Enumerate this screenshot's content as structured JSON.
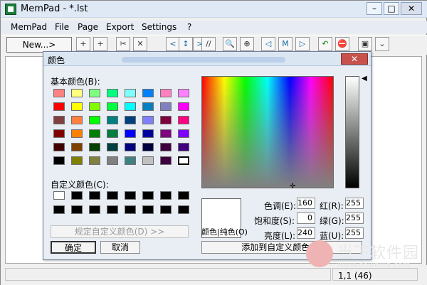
{
  "window": {
    "title": "MemPad - *.lst"
  },
  "menu": [
    "MemPad",
    "File",
    "Page",
    "Export",
    "Settings",
    "?"
  ],
  "toolbar": {
    "new_label": "New...>",
    "tools": [
      {
        "name": "add-page-icon",
        "glyph": "+"
      },
      {
        "name": "add-subpage-icon",
        "glyph": "+"
      },
      {
        "name": "cut-page-icon",
        "glyph": "✂"
      },
      {
        "name": "delete-page-icon",
        "glyph": "✕"
      },
      {
        "name": "move-left-icon",
        "glyph": "<"
      },
      {
        "name": "move-up-down-icon",
        "glyph": "↕"
      },
      {
        "name": "move-right-icon",
        "glyph": ">"
      },
      {
        "name": "comment-icon",
        "glyph": "//"
      },
      {
        "name": "search-icon",
        "glyph": "🔍"
      },
      {
        "name": "search-next-icon",
        "glyph": "⊕"
      },
      {
        "name": "prev-mark-icon",
        "glyph": "◁"
      },
      {
        "name": "mark-icon",
        "glyph": "M"
      },
      {
        "name": "next-mark-icon",
        "glyph": "▷"
      },
      {
        "name": "undo-icon",
        "glyph": "↶"
      },
      {
        "name": "stop-icon",
        "glyph": "⛔"
      },
      {
        "name": "window-icon",
        "glyph": "▣"
      },
      {
        "name": "expand-icon",
        "glyph": "⌄"
      }
    ]
  },
  "status": {
    "position": "1,1 (46)"
  },
  "color_dialog": {
    "title": "颜色",
    "close_label": "✕",
    "basic_colors_label": "基本颜色(B):",
    "basic_colors": [
      "#ff8080",
      "#ffff80",
      "#80ff80",
      "#00ff80",
      "#80ffff",
      "#0080ff",
      "#ff80c0",
      "#ff80ff",
      "#ff0000",
      "#ffff00",
      "#80ff00",
      "#00ff40",
      "#00ffff",
      "#0080c0",
      "#8080c0",
      "#ff00ff",
      "#804040",
      "#ff8040",
      "#00ff00",
      "#008080",
      "#004080",
      "#8080ff",
      "#800040",
      "#ff0080",
      "#800000",
      "#ff8000",
      "#008000",
      "#008040",
      "#0000ff",
      "#0000a0",
      "#800080",
      "#8000ff",
      "#400000",
      "#804000",
      "#004000",
      "#004040",
      "#000080",
      "#000040",
      "#400040",
      "#400080",
      "#000000",
      "#808000",
      "#808040",
      "#808080",
      "#408080",
      "#c0c0c0",
      "#400040",
      "#ffffff"
    ],
    "custom_colors_label": "自定义颜色(C):",
    "custom_colors": [
      "#ffffff",
      "#000000",
      "#000000",
      "#000000",
      "#000000",
      "#000000",
      "#000000",
      "#000000",
      "#000000",
      "#000000",
      "#000000",
      "#000000",
      "#000000",
      "#000000",
      "#000000",
      "#000000"
    ],
    "define_custom_label": "规定自定义颜色(D) >>",
    "ok_label": "确定",
    "cancel_label": "取消",
    "preview_label": "颜色|纯色(O)",
    "hue_label": "色调(E):",
    "hue_value": "160",
    "sat_label": "饱和度(S):",
    "sat_value": "0",
    "lum_label": "亮度(L):",
    "lum_value": "240",
    "red_label": "红(R):",
    "red_value": "255",
    "green_label": "绿(G):",
    "green_value": "255",
    "blue_label": "蓝(U):",
    "blue_value": "255",
    "add_custom_label": "添加到自定义颜色(A)"
  },
  "watermark": {
    "brand": "当下软件园",
    "url": "www.downxia.com"
  }
}
